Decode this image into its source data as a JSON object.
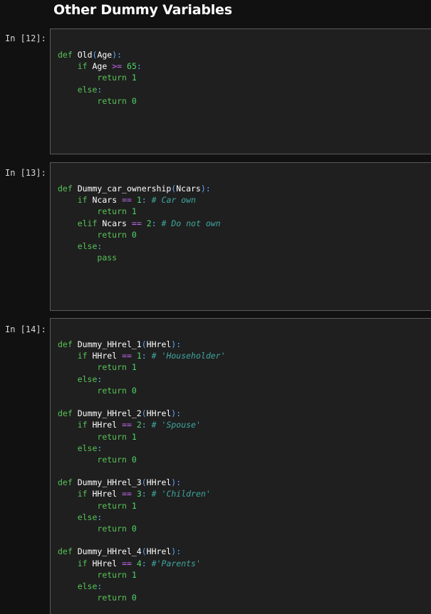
{
  "heading": "Other Dummy Variables",
  "cells": [
    {
      "prompt": "In [12]:",
      "lines": [
        [
          {
            "t": "def",
            "c": "kw"
          },
          {
            "t": " "
          },
          {
            "t": "Old",
            "c": "fn"
          },
          {
            "t": "(",
            "c": "par"
          },
          {
            "t": "Age",
            "c": "var"
          },
          {
            "t": "):",
            "c": "par"
          }
        ],
        [
          {
            "t": "    "
          },
          {
            "t": "if",
            "c": "kw"
          },
          {
            "t": " "
          },
          {
            "t": "Age",
            "c": "var"
          },
          {
            "t": " "
          },
          {
            "t": ">=",
            "c": "op"
          },
          {
            "t": " "
          },
          {
            "t": "65",
            "c": "num"
          },
          {
            "t": ":",
            "c": "par"
          }
        ],
        [
          {
            "t": "        "
          },
          {
            "t": "return",
            "c": "kw"
          },
          {
            "t": " "
          },
          {
            "t": "1",
            "c": "num"
          }
        ],
        [
          {
            "t": "    "
          },
          {
            "t": "else",
            "c": "kw"
          },
          {
            "t": ":",
            "c": "par"
          }
        ],
        [
          {
            "t": "        "
          },
          {
            "t": "return",
            "c": "kw"
          },
          {
            "t": " "
          },
          {
            "t": "0",
            "c": "num"
          }
        ]
      ]
    },
    {
      "prompt": "In [13]:",
      "lines": [
        [
          {
            "t": "def",
            "c": "kw"
          },
          {
            "t": " "
          },
          {
            "t": "Dummy_car_ownership",
            "c": "fn"
          },
          {
            "t": "(",
            "c": "par"
          },
          {
            "t": "Ncars",
            "c": "var"
          },
          {
            "t": "):",
            "c": "par"
          }
        ],
        [
          {
            "t": "    "
          },
          {
            "t": "if",
            "c": "kw"
          },
          {
            "t": " "
          },
          {
            "t": "Ncars",
            "c": "var"
          },
          {
            "t": " "
          },
          {
            "t": "==",
            "c": "op"
          },
          {
            "t": " "
          },
          {
            "t": "1",
            "c": "num"
          },
          {
            "t": ":",
            "c": "par"
          },
          {
            "t": " "
          },
          {
            "t": "# Car own",
            "c": "cm"
          }
        ],
        [
          {
            "t": "        "
          },
          {
            "t": "return",
            "c": "kw"
          },
          {
            "t": " "
          },
          {
            "t": "1",
            "c": "num"
          }
        ],
        [
          {
            "t": "    "
          },
          {
            "t": "elif",
            "c": "kw"
          },
          {
            "t": " "
          },
          {
            "t": "Ncars",
            "c": "var"
          },
          {
            "t": " "
          },
          {
            "t": "==",
            "c": "op"
          },
          {
            "t": " "
          },
          {
            "t": "2",
            "c": "num"
          },
          {
            "t": ":",
            "c": "par"
          },
          {
            "t": " "
          },
          {
            "t": "# Do not own",
            "c": "cm"
          }
        ],
        [
          {
            "t": "        "
          },
          {
            "t": "return",
            "c": "kw"
          },
          {
            "t": " "
          },
          {
            "t": "0",
            "c": "num"
          }
        ],
        [
          {
            "t": "    "
          },
          {
            "t": "else",
            "c": "kw"
          },
          {
            "t": ":",
            "c": "par"
          }
        ],
        [
          {
            "t": "        "
          },
          {
            "t": "pass",
            "c": "kw"
          }
        ]
      ]
    },
    {
      "prompt": "In [14]:",
      "lines": [
        [
          {
            "t": "def",
            "c": "kw"
          },
          {
            "t": " "
          },
          {
            "t": "Dummy_HHrel_1",
            "c": "fn"
          },
          {
            "t": "(",
            "c": "par"
          },
          {
            "t": "HHrel",
            "c": "var"
          },
          {
            "t": "):",
            "c": "par"
          }
        ],
        [
          {
            "t": "    "
          },
          {
            "t": "if",
            "c": "kw"
          },
          {
            "t": " "
          },
          {
            "t": "HHrel",
            "c": "var"
          },
          {
            "t": " "
          },
          {
            "t": "==",
            "c": "op"
          },
          {
            "t": " "
          },
          {
            "t": "1",
            "c": "num"
          },
          {
            "t": ":",
            "c": "par"
          },
          {
            "t": " "
          },
          {
            "t": "# 'Householder'",
            "c": "cm"
          }
        ],
        [
          {
            "t": "        "
          },
          {
            "t": "return",
            "c": "kw"
          },
          {
            "t": " "
          },
          {
            "t": "1",
            "c": "num"
          }
        ],
        [
          {
            "t": "    "
          },
          {
            "t": "else",
            "c": "kw"
          },
          {
            "t": ":",
            "c": "par"
          }
        ],
        [
          {
            "t": "        "
          },
          {
            "t": "return",
            "c": "kw"
          },
          {
            "t": " "
          },
          {
            "t": "0",
            "c": "num"
          }
        ],
        [],
        [
          {
            "t": "def",
            "c": "kw"
          },
          {
            "t": " "
          },
          {
            "t": "Dummy_HHrel_2",
            "c": "fn"
          },
          {
            "t": "(",
            "c": "par"
          },
          {
            "t": "HHrel",
            "c": "var"
          },
          {
            "t": "):",
            "c": "par"
          }
        ],
        [
          {
            "t": "    "
          },
          {
            "t": "if",
            "c": "kw"
          },
          {
            "t": " "
          },
          {
            "t": "HHrel",
            "c": "var"
          },
          {
            "t": " "
          },
          {
            "t": "==",
            "c": "op"
          },
          {
            "t": " "
          },
          {
            "t": "2",
            "c": "num"
          },
          {
            "t": ":",
            "c": "par"
          },
          {
            "t": " "
          },
          {
            "t": "# 'Spouse'",
            "c": "cm"
          }
        ],
        [
          {
            "t": "        "
          },
          {
            "t": "return",
            "c": "kw"
          },
          {
            "t": " "
          },
          {
            "t": "1",
            "c": "num"
          }
        ],
        [
          {
            "t": "    "
          },
          {
            "t": "else",
            "c": "kw"
          },
          {
            "t": ":",
            "c": "par"
          }
        ],
        [
          {
            "t": "        "
          },
          {
            "t": "return",
            "c": "kw"
          },
          {
            "t": " "
          },
          {
            "t": "0",
            "c": "num"
          }
        ],
        [],
        [
          {
            "t": "def",
            "c": "kw"
          },
          {
            "t": " "
          },
          {
            "t": "Dummy_HHrel_3",
            "c": "fn"
          },
          {
            "t": "(",
            "c": "par"
          },
          {
            "t": "HHrel",
            "c": "var"
          },
          {
            "t": "):",
            "c": "par"
          }
        ],
        [
          {
            "t": "    "
          },
          {
            "t": "if",
            "c": "kw"
          },
          {
            "t": " "
          },
          {
            "t": "HHrel",
            "c": "var"
          },
          {
            "t": " "
          },
          {
            "t": "==",
            "c": "op"
          },
          {
            "t": " "
          },
          {
            "t": "3",
            "c": "num"
          },
          {
            "t": ":",
            "c": "par"
          },
          {
            "t": " "
          },
          {
            "t": "# 'Children'",
            "c": "cm"
          }
        ],
        [
          {
            "t": "        "
          },
          {
            "t": "return",
            "c": "kw"
          },
          {
            "t": " "
          },
          {
            "t": "1",
            "c": "num"
          }
        ],
        [
          {
            "t": "    "
          },
          {
            "t": "else",
            "c": "kw"
          },
          {
            "t": ":",
            "c": "par"
          }
        ],
        [
          {
            "t": "        "
          },
          {
            "t": "return",
            "c": "kw"
          },
          {
            "t": " "
          },
          {
            "t": "0",
            "c": "num"
          }
        ],
        [],
        [
          {
            "t": "def",
            "c": "kw"
          },
          {
            "t": " "
          },
          {
            "t": "Dummy_HHrel_4",
            "c": "fn"
          },
          {
            "t": "(",
            "c": "par"
          },
          {
            "t": "HHrel",
            "c": "var"
          },
          {
            "t": "):",
            "c": "par"
          }
        ],
        [
          {
            "t": "    "
          },
          {
            "t": "if",
            "c": "kw"
          },
          {
            "t": " "
          },
          {
            "t": "HHrel",
            "c": "var"
          },
          {
            "t": " "
          },
          {
            "t": "==",
            "c": "op"
          },
          {
            "t": " "
          },
          {
            "t": "4",
            "c": "num"
          },
          {
            "t": ":",
            "c": "par"
          },
          {
            "t": " "
          },
          {
            "t": "#'Parents'",
            "c": "cm"
          }
        ],
        [
          {
            "t": "        "
          },
          {
            "t": "return",
            "c": "kw"
          },
          {
            "t": " "
          },
          {
            "t": "1",
            "c": "num"
          }
        ],
        [
          {
            "t": "    "
          },
          {
            "t": "else",
            "c": "kw"
          },
          {
            "t": ":",
            "c": "par"
          }
        ],
        [
          {
            "t": "        "
          },
          {
            "t": "return",
            "c": "kw"
          },
          {
            "t": " "
          },
          {
            "t": "0",
            "c": "num"
          }
        ]
      ]
    }
  ]
}
